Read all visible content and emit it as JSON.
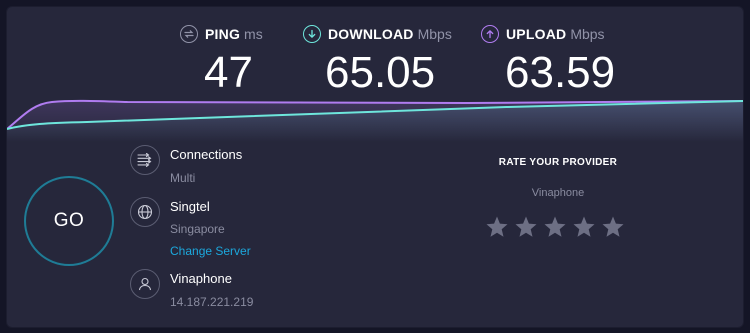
{
  "metrics": {
    "ping": {
      "label": "PING",
      "unit": "ms",
      "value": "47",
      "icon": "ping-icon",
      "color": "#9193a8"
    },
    "download": {
      "label": "DOWNLOAD",
      "unit": "Mbps",
      "value": "65.05",
      "icon": "download-icon",
      "color": "#6ee6dc"
    },
    "upload": {
      "label": "UPLOAD",
      "unit": "Mbps",
      "value": "63.59",
      "icon": "upload-icon",
      "color": "#b07cf0"
    }
  },
  "go_button": {
    "label": "GO"
  },
  "connections": {
    "title": "Connections",
    "value": "Multi",
    "icon": "connections-icon"
  },
  "server": {
    "name": "Singtel",
    "location": "Singapore",
    "change_label": "Change Server",
    "icon": "globe-icon"
  },
  "provider": {
    "name": "Vinaphone",
    "ip": "14.187.221.219",
    "icon": "user-icon"
  },
  "rating": {
    "title": "RATE YOUR PROVIDER",
    "provider": "Vinaphone",
    "stars_total": 5,
    "stars_selected": 0
  },
  "colors": {
    "background": "#141526",
    "panel": "#26273b",
    "download": "#6ee6dc",
    "upload": "#b07cf0",
    "link": "#1ca8dd",
    "star": "#6d6f84"
  }
}
